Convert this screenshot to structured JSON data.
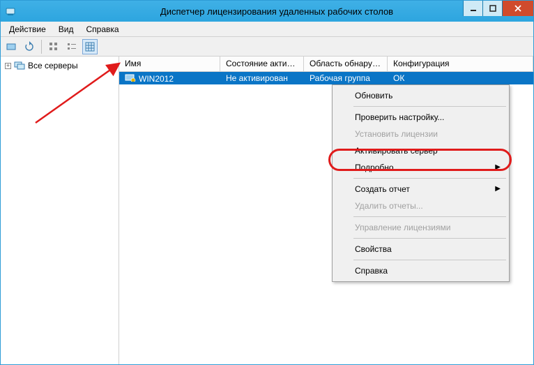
{
  "titlebar": {
    "title": "Диспетчер лицензирования удаленных рабочих столов"
  },
  "menu": {
    "action": "Действие",
    "view": "Вид",
    "help": "Справка"
  },
  "sidebar": {
    "root": "Все серверы"
  },
  "columns": {
    "name": "Имя",
    "state": "Состояние актива...",
    "scope": "Область обнаруже...",
    "config": "Конфигурация"
  },
  "row": {
    "name": "WIN2012",
    "state": "Не активирован",
    "scope": "Рабочая группа",
    "config": "ОК"
  },
  "ctx": {
    "refresh": "Обновить",
    "check": "Проверить настройку...",
    "install": "Установить лицензии",
    "activate": "Активировать сервер",
    "more": "Подробно",
    "report": "Создать отчет",
    "delreports": "Удалить отчеты...",
    "manage": "Управление лицензиями",
    "props": "Свойства",
    "help": "Справка"
  }
}
